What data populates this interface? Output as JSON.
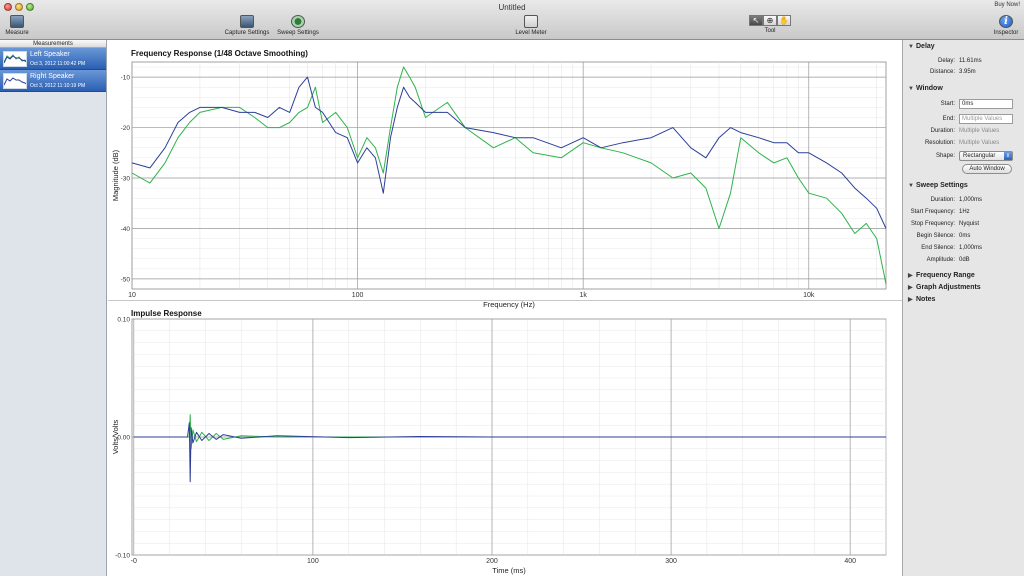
{
  "window": {
    "title": "Untitled",
    "buy_now": "Buy Now!"
  },
  "toolbar": {
    "measure": "Measure",
    "capture_settings": "Capture Settings",
    "sweep_settings": "Sweep Settings",
    "level_meter": "Level Meter",
    "tool": "Tool",
    "inspector": "Inspector",
    "inspector_glyph": "i"
  },
  "sidebar": {
    "header": "Measurements",
    "items": [
      {
        "name": "Left Speaker",
        "date": "Oct 3, 2012 11:00:42 PM"
      },
      {
        "name": "Right Speaker",
        "date": "Oct 3, 2012 11:10:19 PM"
      }
    ]
  },
  "chart_data": [
    {
      "type": "line",
      "title": "Frequency Response (1/48 Octave Smoothing)",
      "xlabel": "Frequency (Hz)",
      "ylabel": "Magnitude (dB)",
      "x_scale": "log",
      "xlim": [
        10,
        22000
      ],
      "ylim": [
        -52,
        -7
      ],
      "x_ticks": [
        "10",
        "100",
        "1k",
        "10k"
      ],
      "x_tick_values": [
        10,
        100,
        1000,
        10000
      ],
      "y_ticks": [
        "-10",
        "-20",
        "-30",
        "-40",
        "-50"
      ],
      "y_tick_values": [
        -10,
        -20,
        -30,
        -40,
        -50
      ],
      "grid": true,
      "series": [
        {
          "color": "#2db34a",
          "x": [
            10,
            12,
            14,
            16,
            18,
            20,
            25,
            30,
            35,
            40,
            45,
            50,
            55,
            60,
            65,
            70,
            80,
            90,
            100,
            110,
            120,
            130,
            140,
            150,
            160,
            170,
            180,
            200,
            250,
            300,
            400,
            500,
            600,
            800,
            1000,
            1200,
            1500,
            2000,
            2500,
            3000,
            3500,
            4000,
            4500,
            5000,
            6000,
            7000,
            8000,
            9000,
            10000,
            12000,
            14000,
            16000,
            18000,
            20000,
            22000
          ],
          "y": [
            -29,
            -31,
            -27,
            -22,
            -19,
            -17,
            -16,
            -16,
            -18,
            -20,
            -20,
            -19,
            -17,
            -16,
            -12,
            -19,
            -17,
            -20,
            -26,
            -22,
            -24,
            -29,
            -20,
            -12,
            -8,
            -10,
            -12,
            -18,
            -15,
            -20,
            -24,
            -22,
            -25,
            -26,
            -23,
            -24,
            -25,
            -27,
            -30,
            -29,
            -32,
            -40,
            -33,
            -22,
            -25,
            -27,
            -26,
            -30,
            -33,
            -34,
            -37,
            -41,
            -39,
            -42,
            -51
          ]
        },
        {
          "color": "#2c3e99",
          "x": [
            10,
            12,
            14,
            16,
            18,
            20,
            25,
            30,
            35,
            40,
            45,
            50,
            55,
            60,
            65,
            70,
            80,
            90,
            100,
            110,
            120,
            130,
            140,
            150,
            160,
            170,
            180,
            200,
            250,
            300,
            400,
            500,
            600,
            800,
            1000,
            1200,
            1500,
            2000,
            2500,
            3000,
            3500,
            4000,
            4500,
            5000,
            6000,
            7000,
            8000,
            9000,
            10000,
            12000,
            14000,
            16000,
            18000,
            20000,
            22000
          ],
          "y": [
            -27,
            -28,
            -24,
            -19,
            -17,
            -16,
            -16,
            -17,
            -17,
            -18,
            -16,
            -17,
            -12,
            -10,
            -16,
            -17,
            -21,
            -22,
            -27,
            -24,
            -26,
            -33,
            -22,
            -16,
            -12,
            -14,
            -15,
            -17,
            -17,
            -20,
            -21,
            -22,
            -22,
            -24,
            -22,
            -24,
            -23,
            -22,
            -20,
            -24,
            -26,
            -22,
            -20,
            -21,
            -22,
            -23,
            -23,
            -25,
            -25,
            -27,
            -29,
            -32,
            -34,
            -36,
            -40
          ]
        }
      ]
    },
    {
      "type": "line",
      "title": "Impulse Response",
      "xlabel": "Time (ms)",
      "ylabel": "Volts/Volts",
      "xlim": [
        -1,
        420
      ],
      "ylim": [
        -0.1,
        0.1
      ],
      "x_ticks": [
        "-0",
        "100",
        "200",
        "300",
        "400"
      ],
      "x_tick_values": [
        0,
        100,
        200,
        300,
        400
      ],
      "y_ticks": [
        "0.10",
        "0.00",
        "-0.10"
      ],
      "y_tick_values": [
        0.1,
        0.0,
        -0.1
      ],
      "grid": true,
      "series": [
        {
          "color": "#2db34a",
          "x": [
            0,
            30,
            31,
            31.5,
            32,
            33,
            35,
            38,
            42,
            46,
            50,
            60,
            80,
            100,
            420
          ],
          "y": [
            0,
            0,
            0.0,
            0.019,
            -0.01,
            0.006,
            -0.004,
            0.004,
            -0.003,
            0.003,
            -0.002,
            0.001,
            0,
            0,
            0
          ]
        },
        {
          "color": "#2c3e99",
          "x": [
            0,
            30,
            31,
            31.5,
            32,
            33,
            35,
            38,
            42,
            46,
            50,
            60,
            80,
            120,
            160,
            200,
            420
          ],
          "y": [
            0,
            0,
            0.012,
            -0.038,
            0.008,
            -0.005,
            0.004,
            -0.003,
            0.003,
            -0.002,
            0.002,
            -0.001,
            0.001,
            -0.0005,
            0.0004,
            0,
            0
          ]
        }
      ]
    }
  ],
  "inspector": {
    "delay": {
      "header": "Delay",
      "delay_label": "Delay:",
      "delay_value": "11.61ms",
      "distance_label": "Distance:",
      "distance_value": "3.95m"
    },
    "window": {
      "header": "Window",
      "start_label": "Start:",
      "start_value": "0ms",
      "end_label": "End:",
      "end_placeholder": "Multiple Values",
      "duration_label": "Duration:",
      "duration_value": "Multiple Values",
      "resolution_label": "Resolution:",
      "resolution_value": "Multiple Values",
      "shape_label": "Shape:",
      "shape_value": "Rectangular",
      "auto_window": "Auto Window"
    },
    "sweep": {
      "header": "Sweep Settings",
      "duration_label": "Duration:",
      "duration_value": "1,000ms",
      "start_freq_label": "Start Frequency:",
      "start_freq_value": "1Hz",
      "stop_freq_label": "Stop Frequency:",
      "stop_freq_value": "Nyquist",
      "begin_silence_label": "Begin Silence:",
      "begin_silence_value": "0ms",
      "end_silence_label": "End Silence:",
      "end_silence_value": "1,000ms",
      "amplitude_label": "Amplitude:",
      "amplitude_value": "0dB"
    },
    "frequency_range": "Frequency Range",
    "graph_adjustments": "Graph Adjustments",
    "notes": "Notes"
  }
}
